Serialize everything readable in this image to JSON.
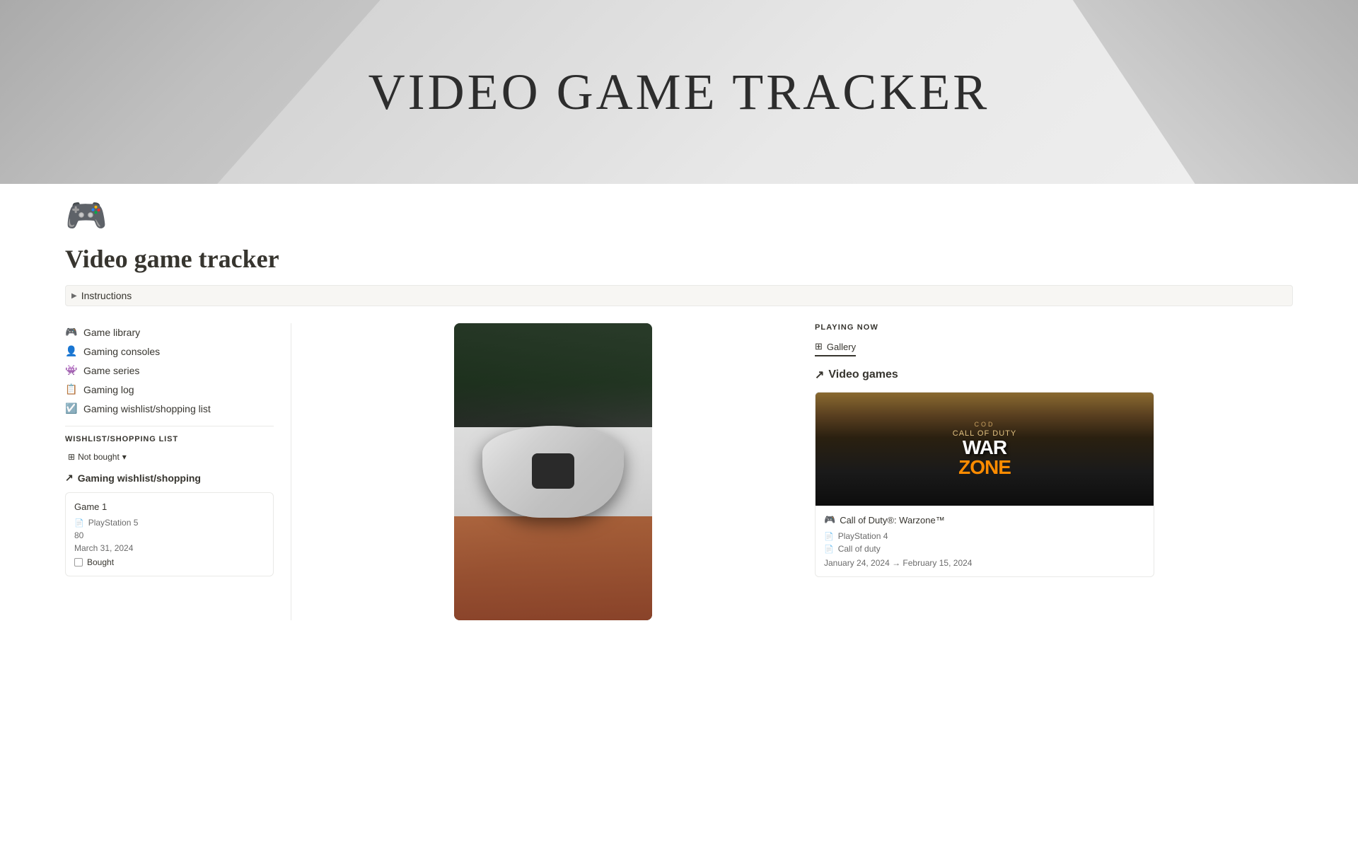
{
  "hero": {
    "title": "VIDEO GAME TRACKER"
  },
  "page": {
    "icon": "🎮",
    "title": "Video game tracker"
  },
  "instructions": {
    "label": "Instructions"
  },
  "nav": {
    "items": [
      {
        "id": "game-library",
        "icon": "🎮",
        "label": "Game library"
      },
      {
        "id": "gaming-consoles",
        "icon": "👤",
        "label": "Gaming consoles"
      },
      {
        "id": "game-series",
        "icon": "👾",
        "label": "Game series"
      },
      {
        "id": "gaming-log",
        "icon": "📋",
        "label": "Gaming log"
      },
      {
        "id": "gaming-wishlist",
        "icon": "☑️",
        "label": "Gaming wishlist/shopping list"
      }
    ]
  },
  "wishlist": {
    "section_title": "WISHLIST/SHOPPING LIST",
    "filter_label": "Not bought",
    "link_label": "Gaming wishlist/shopping",
    "game_card": {
      "title": "Game 1",
      "platform": "PlayStation 5",
      "price": "80",
      "date": "March 31, 2024",
      "bought_label": "Bought"
    }
  },
  "playing_now": {
    "title": "PLAYING NOW",
    "gallery_tab": "Gallery",
    "video_games_link": "Video games",
    "game": {
      "name": "Call of Duty®: Warzone™",
      "platform": "PlayStation 4",
      "series": "Call of duty",
      "date_range": "January 24, 2024 → February 15, 2024"
    }
  },
  "icons": {
    "arrow_right": "▶",
    "arrow_up_right": "↗",
    "grid": "⊞",
    "filter_down": "▾",
    "doc": "📄",
    "controller": "🎮"
  }
}
